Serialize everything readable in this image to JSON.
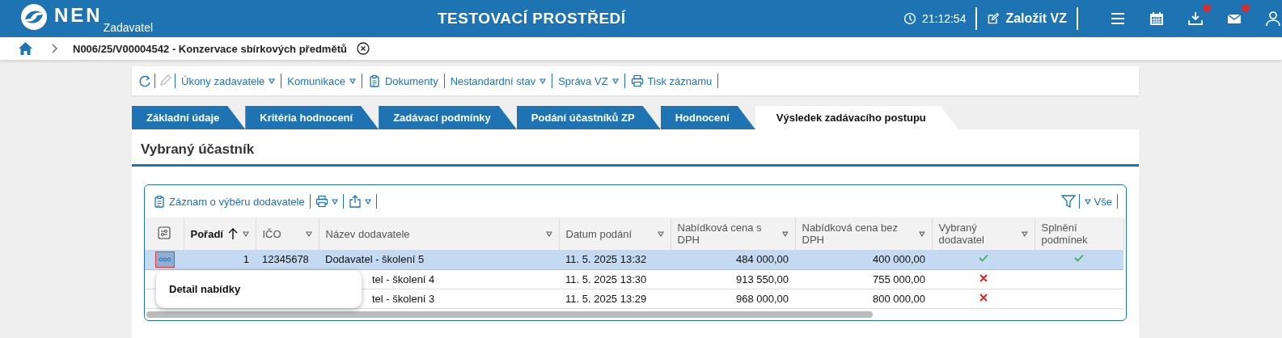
{
  "header": {
    "logo": "NEN",
    "app": "Zadavatel",
    "title": "TESTOVACÍ PROSTŘEDÍ",
    "time": "21:12:54",
    "create_button": "Založit VZ",
    "actions": [
      {
        "kind": "menu",
        "badge": false
      },
      {
        "kind": "calendar",
        "badge": false
      },
      {
        "kind": "download",
        "badge": true
      },
      {
        "kind": "mail",
        "badge": true
      },
      {
        "kind": "user",
        "badge": false
      }
    ]
  },
  "breadcrumb": {
    "title": "N006/25/V00004542 - Konzervace sbírkových předmětů"
  },
  "toolbar": [
    {
      "kind": "refresh",
      "disabled": false
    },
    {
      "kind": "edit",
      "disabled": true
    },
    {
      "kind": "menu",
      "label": "Úkony zadavatele"
    },
    {
      "kind": "menu",
      "label": "Komunikace"
    },
    {
      "kind": "doc",
      "label": "Dokumenty"
    },
    {
      "kind": "menu",
      "label": "Nestandardní stav"
    },
    {
      "kind": "menu",
      "label": "Správa VZ"
    },
    {
      "kind": "print",
      "label": "Tisk záznamu"
    }
  ],
  "tabs": [
    {
      "label": "Základní údaje",
      "selected": false
    },
    {
      "label": "Kritéria hodnocení",
      "selected": false
    },
    {
      "label": "Zadávací podmínky",
      "selected": false
    },
    {
      "label": "Podání účastníků ZP",
      "selected": false
    },
    {
      "label": "Hodnocení",
      "selected": false
    },
    {
      "label": "Výsledek zadávacího postupu",
      "selected": true
    }
  ],
  "section": {
    "title": "Vybraný účastník"
  },
  "table": {
    "toolbar": {
      "record_button": "Záznam o výběru dodavatele",
      "filter_label": "Vše"
    },
    "columns": [
      {
        "label": "Pořadí",
        "sorted": true
      },
      {
        "label": "IČO",
        "sorted": false
      },
      {
        "label": "Název dodavatele",
        "sorted": false
      },
      {
        "label": "Datum podání",
        "sorted": false
      },
      {
        "label": "Nabídková cena s DPH",
        "sorted": false
      },
      {
        "label": "Nabídková cena bez DPH",
        "sorted": false
      },
      {
        "label": "Vybraný dodavatel",
        "sorted": false
      },
      {
        "label": "Splnění podmínek",
        "sorted": false
      }
    ],
    "rows": [
      {
        "selected": true,
        "menu_button": true,
        "order": "1",
        "ico": "12345678",
        "name": "Dodavatel - školení 5",
        "date": "11. 5. 2025 13:32",
        "price_vat": "484 000,00",
        "price": "400 000,00",
        "chosen": true,
        "conditions_met": true
      },
      {
        "selected": false,
        "menu_button": false,
        "name": "tel - školení 4",
        "date": "11. 5. 2025 13:30",
        "price_vat": "913 550,00",
        "price": "755 000,00",
        "chosen": false
      },
      {
        "selected": false,
        "menu_button": false,
        "name": "tel - školení 3",
        "date": "11. 5. 2025 13:29",
        "price_vat": "968 000,00",
        "price": "800 000,00",
        "chosen": false
      }
    ],
    "popup": {
      "items": [
        "Detail nabídky"
      ]
    }
  }
}
